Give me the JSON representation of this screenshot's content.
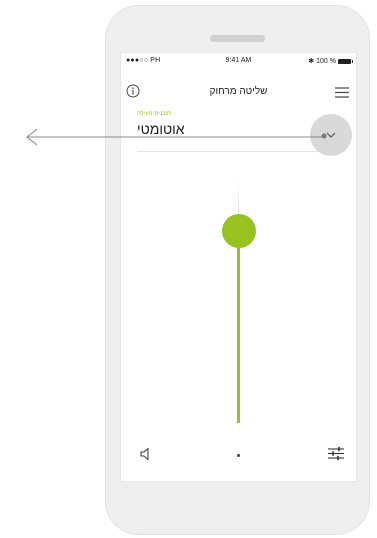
{
  "status_bar": {
    "carrier": "●●●○○ PH",
    "time": "9:41 AM",
    "battery": "100 %"
  },
  "header": {
    "title": "שליטה מרחוק",
    "info_icon": "info-icon",
    "menu_icon": "hamburger-menu-icon"
  },
  "program": {
    "caption": "תוכנית פעילה",
    "value": "אוטומטי",
    "dropdown_icon": "chevron-down-icon"
  },
  "volume": {
    "level": 0.85
  },
  "bottom_bar": {
    "left_icon": "speaker-icon",
    "center_icon": "page-dot",
    "right_icon": "sliders-icon"
  },
  "colors": {
    "accent": "#97c21f",
    "phone": "#efefef",
    "dropdown_bg": "#d9d9d9",
    "text": "#1d1d1d"
  }
}
